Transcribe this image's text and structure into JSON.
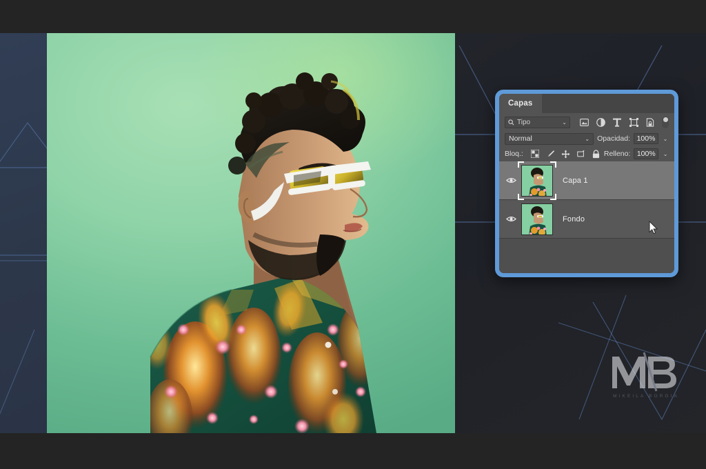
{
  "app": {
    "panel_title": "Capas"
  },
  "filter": {
    "search_icon": "search-icon",
    "type_label": "Tipo",
    "chevron": "⌄",
    "icons": [
      {
        "name": "pixel-layer-filter-icon",
        "glyph": "image"
      },
      {
        "name": "adjustment-layer-filter-icon",
        "glyph": "half-circle"
      },
      {
        "name": "type-layer-filter-icon",
        "glyph": "T"
      },
      {
        "name": "shape-layer-filter-icon",
        "glyph": "frame"
      },
      {
        "name": "smart-object-filter-icon",
        "glyph": "lock-page"
      }
    ],
    "toggle_name": "filter-enable-toggle"
  },
  "blend": {
    "mode": "Normal",
    "opacity_label": "Opacidad:",
    "opacity_value": "100%",
    "chevron": "⌄"
  },
  "lock": {
    "label": "Bloq.:",
    "fill_label": "Relleno:",
    "fill_value": "100%",
    "icons": [
      {
        "name": "lock-transparent-pixels-icon",
        "glyph": "checker"
      },
      {
        "name": "lock-image-pixels-icon",
        "glyph": "brush"
      },
      {
        "name": "lock-position-icon",
        "glyph": "move"
      },
      {
        "name": "prevent-nesting-icon",
        "glyph": "artboard"
      },
      {
        "name": "lock-all-icon",
        "glyph": "padlock"
      }
    ]
  },
  "layers": [
    {
      "name": "Capa 1",
      "visible": true,
      "selected": true
    },
    {
      "name": "Fondo",
      "visible": true,
      "selected": false
    }
  ],
  "watermark": {
    "monogram": "MB",
    "subtitle": "MIKEILA BORGIA"
  },
  "colors": {
    "panel_border": "#5f9ad8",
    "panel_bg": "#535353",
    "layer_selected": "#787878",
    "layer_row": "#585858",
    "canvas_green": "#8fd3a8",
    "backdrop_navy": "#2e3b52",
    "backdrop_dark": "#21232a",
    "bar_dark": "#242424"
  }
}
